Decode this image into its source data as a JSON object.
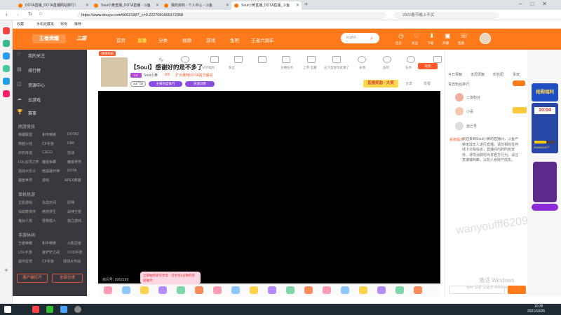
{
  "browser": {
    "tabs": [
      {
        "label": "DOTA直播_DOTA直播网站排行！"
      },
      {
        "label": "Soul小黄直播_DOTA直播 - 斗鱼"
      },
      {
        "label": "我的资料 - 个人中心 - 斗鱼"
      },
      {
        "label": "Soul小黄直播_DOTA直播_斗鱼"
      }
    ],
    "url": "https://www.douyu.com/5062199?_c=0.2227091609172358",
    "search_placeholder": "2022春节晚上不买",
    "bookmarks": [
      "收藏",
      "手机收藏夹",
      "常用",
      "推荐"
    ]
  },
  "site": {
    "logo": "王者荣耀",
    "logo2": "三国",
    "nav": [
      "首页",
      "直播",
      "分类",
      "视频",
      "游戏",
      "鱼吧",
      "王者六周年"
    ],
    "active_nav": "直播",
    "search_value": "loyBF",
    "right_icons": [
      "历史",
      "关注",
      "下载",
      "开播",
      "客服"
    ]
  },
  "sidebar": {
    "top_items": [
      "我的关注",
      "排行榜",
      "资源中心",
      "云游戏",
      "赛事"
    ],
    "sections": [
      {
        "title": "网游竞技",
        "items": [
          "英雄联盟",
          "和平精英",
          "DOTA2",
          "穿越火线",
          "CF手游",
          "DNF",
          "炉石传说",
          "CSGO",
          "逆战",
          "LOL云顶之弈",
          "魔兽争霸",
          "魔兽世界",
          "逆战大乐斗",
          "暗黑破坏神",
          "DOTA",
          "魔兽世界",
          "游戏",
          "APEX英雄"
        ]
      },
      {
        "title": "单机热游",
        "items": [
          "主机游戏",
          "永劫无间",
          "原神",
          "仙剑奇侠传",
          "绝地求生",
          "战神王者",
          "鬼谷八荒",
          "怪物猎人",
          "独立游戏"
        ]
      },
      {
        "title": "手游休闲",
        "items": [
          "王者荣耀",
          "和平精英",
          "火影忍者",
          "LOL手游",
          "金铲铲之战",
          "COD手游",
          "崩坏星穹",
          "CF手游",
          "球球大作战"
        ]
      }
    ],
    "bottom_buttons": [
      "客户端打开",
      "全部分类"
    ]
  },
  "room": {
    "badge": "直播奖励",
    "title": "【Soul】感谢好的是不多了",
    "streamer": "Soul小黄",
    "followers": "105",
    "room_label": "扩大推荐DOTA官方解说",
    "tags": [
      "S2门派",
      "主播热度排行",
      "逍遥剑客"
    ],
    "id_text": "房间号: 5062199",
    "tool_items": [
      "有奖",
      "关于房间",
      "分享",
      "粉丝",
      "分享福利",
      "主播任务",
      "上传·宝藏",
      "这下直接你就猜了",
      "表情",
      "鱼吧",
      "任务",
      "小游戏",
      "举报",
      "成就"
    ],
    "top_right_buttons": [
      "分享",
      "举报"
    ],
    "banner": "直播奖励 · 大奖"
  },
  "gift_bar": {
    "count": 18,
    "notice": "立即抽奖即可享受 · 可享有1分钟的奖励抽奖"
  },
  "right_panel": {
    "tabs": [
      "今日贡献",
      "本周贡献",
      "粉丝团",
      "贵宾"
    ],
    "rank_title": "贵宾粉丝排行",
    "users": [
      {
        "name": "二货粉丝"
      },
      {
        "name": "小喜"
      },
      {
        "name": "自己号"
      }
    ],
    "system_label": "系统提示:",
    "system_msg": "欢迎来到Soul小黄的直播间，斗鱼严禁未成年人进行直播，请勿相信任何线下交易信息，直播间内的所有宣传、诱导消费均为非官方行为，请注意谨慎判断，以防人身财产损失。",
    "watermark": "激活 Windows",
    "watermark_sub": "转到“设置”以激活 Windows。"
  },
  "promo": {
    "title": "抢购福利",
    "countdown": "10:04",
    "progress_label": "3556/6200个"
  },
  "overlay_watermark": "wanyoufff6209",
  "taskbar": {
    "time": "20:35",
    "date": "2021/10/26"
  }
}
